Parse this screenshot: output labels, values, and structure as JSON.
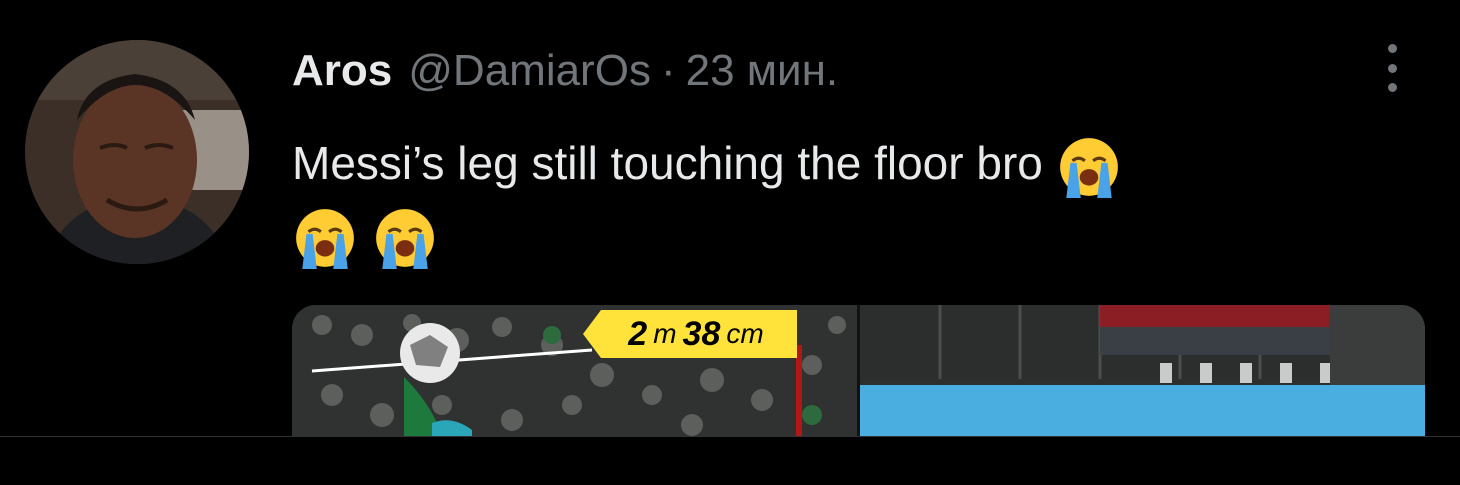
{
  "tweet": {
    "author_name": "Aros",
    "handle": "@DamiarOs",
    "separator": "·",
    "time": "23 мин.",
    "text": "Messi’s leg still touching the floor bro",
    "emojis": [
      "loudly-crying-face-emoji",
      "loudly-crying-face-emoji",
      "loudly-crying-face-emoji"
    ]
  },
  "media": {
    "overlay_number_1": "2",
    "overlay_unit_1": "m",
    "overlay_number_2": "38",
    "overlay_unit_2": "cm"
  },
  "icons": {
    "more": "more-vertical-icon"
  },
  "colors": {
    "background": "#000000",
    "text_primary": "#e7e9ea",
    "text_secondary": "#71767b",
    "measure_tag": "#ffe23a"
  }
}
